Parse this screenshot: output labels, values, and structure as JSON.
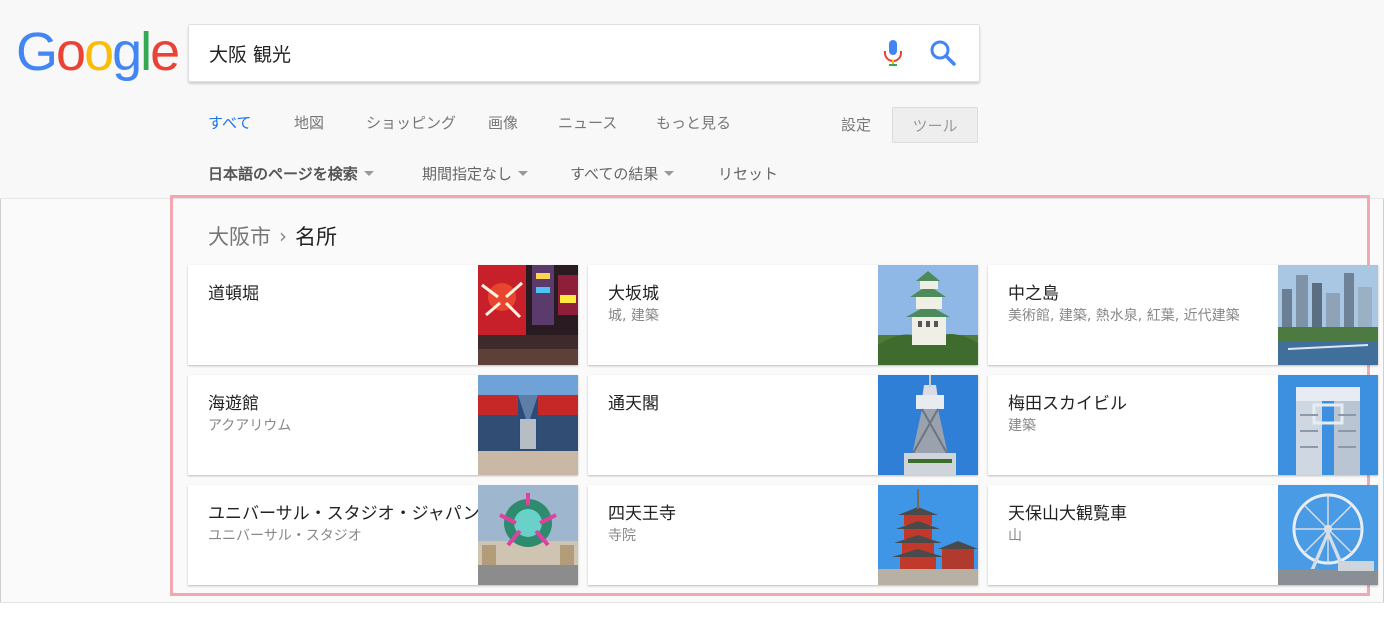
{
  "logo": {
    "letters": [
      "G",
      "o",
      "o",
      "g",
      "l",
      "e"
    ]
  },
  "search": {
    "value": "大阪 観光"
  },
  "tabs": [
    {
      "label": "すべて",
      "active": true
    },
    {
      "label": "地図"
    },
    {
      "label": "ショッピング"
    },
    {
      "label": "画像"
    },
    {
      "label": "ニュース"
    },
    {
      "label": "もっと見る"
    }
  ],
  "toolbar": {
    "settings_label": "設定",
    "tools_label": "ツール"
  },
  "filters": [
    {
      "label": "日本語のページを検索"
    },
    {
      "label": "期間指定なし"
    },
    {
      "label": "すべての結果"
    },
    {
      "label": "リセット"
    }
  ],
  "breadcrumb": {
    "parent": "大阪市",
    "separator": "›",
    "current": "名所"
  },
  "places": [
    {
      "title": "道頓堀",
      "subtitle": ""
    },
    {
      "title": "大坂城",
      "subtitle": "城, 建築"
    },
    {
      "title": "中之島",
      "subtitle": "美術館, 建築, 熱水泉, 紅葉, 近代建築"
    },
    {
      "title": "海遊館",
      "subtitle": "アクアリウム"
    },
    {
      "title": "通天閣",
      "subtitle": ""
    },
    {
      "title": "梅田スカイビル",
      "subtitle": "建築"
    },
    {
      "title": "ユニバーサル・スタジオ・ジャパン",
      "subtitle": "ユニバーサル・スタジオ"
    },
    {
      "title": "四天王寺",
      "subtitle": "寺院"
    },
    {
      "title": "天保山大観覧車",
      "subtitle": "山"
    }
  ],
  "colors": {
    "accent": "#1a73e8",
    "highlight_border": "#f3a8b0"
  }
}
